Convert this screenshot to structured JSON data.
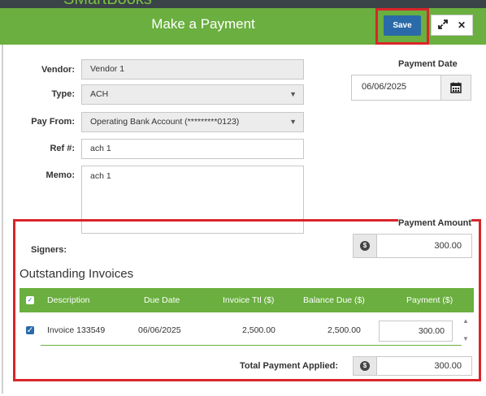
{
  "background_title": "SMartBooks",
  "modal": {
    "title": "Make a Payment",
    "save_label": "Save"
  },
  "form": {
    "vendor_label": "Vendor:",
    "vendor_value": "Vendor 1",
    "type_label": "Type:",
    "type_value": "ACH",
    "pay_from_label": "Pay From:",
    "pay_from_value": "Operating Bank Account (*********0123)",
    "ref_label": "Ref #:",
    "ref_value": "ach 1",
    "memo_label": "Memo:",
    "memo_value": "ach 1",
    "payment_date_label": "Payment Date",
    "payment_date_value": "06/06/2025",
    "payment_amount_label": "Payment Amount",
    "payment_amount_value": "300.00",
    "signers_label": "Signers:"
  },
  "invoices": {
    "section_title": "Outstanding Invoices",
    "headers": [
      "Description",
      "Due Date",
      "Invoice Ttl ($)",
      "Balance Due ($)",
      "Payment ($)"
    ],
    "rows": [
      {
        "description": "Invoice 133549",
        "due_date": "06/06/2025",
        "invoice_total": "2,500.00",
        "balance_due": "2,500.00",
        "payment": "300.00"
      }
    ],
    "total_label": "Total Payment Applied:",
    "total_value": "300.00"
  },
  "colors": {
    "header_green": "#6aaf3f",
    "save_blue": "#2a6aa8",
    "highlight_red": "#d9252a"
  },
  "icons": {
    "calendar": "calendar-icon",
    "dollar": "dollar-icon",
    "expand": "expand-icon",
    "close": "close-icon"
  }
}
